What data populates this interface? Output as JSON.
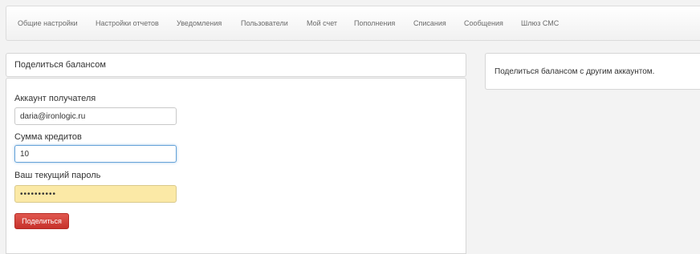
{
  "nav": {
    "items": [
      {
        "label": "Общие настройки"
      },
      {
        "label": "Настройки отчетов"
      },
      {
        "label": "Уведомления"
      },
      {
        "label": "Пользователи"
      },
      {
        "label": "Мой счет"
      },
      {
        "label": "Пополнения"
      },
      {
        "label": "Списания"
      },
      {
        "label": "Сообщения"
      },
      {
        "label": "Шлюз СМС"
      }
    ]
  },
  "panel": {
    "title": "Поделиться балансом"
  },
  "form": {
    "recipient_label": "Аккаунт получателя",
    "recipient_value": "daria@ironlogic.ru",
    "credits_label": "Сумма кредитов",
    "credits_value": "10",
    "password_label": "Ваш текущий пароль",
    "password_mask": "••••••••••",
    "submit_label": "Поделиться"
  },
  "info": {
    "text": "Поделиться балансом с другим аккаунтом."
  },
  "colors": {
    "accent_button": "#d0382f",
    "focus_border": "#66a3d9",
    "autofill_bg": "#fbe9a6"
  }
}
